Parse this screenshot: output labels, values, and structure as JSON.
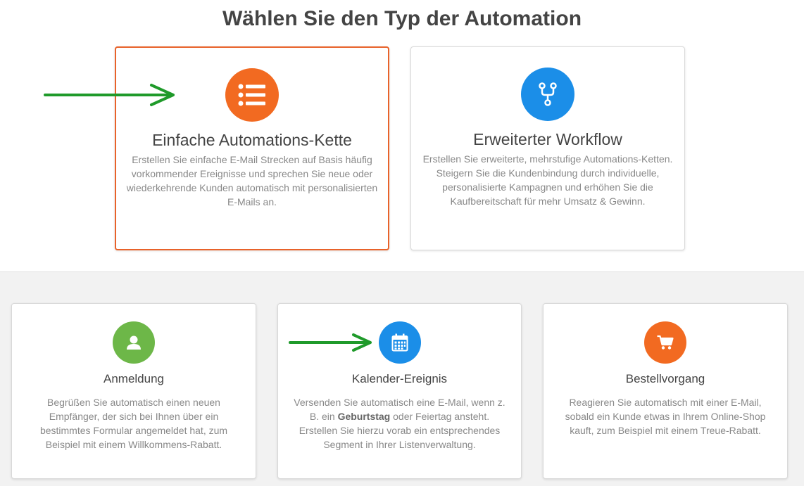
{
  "page": {
    "title": "Wählen Sie den Typ der Automation"
  },
  "cards_top": [
    {
      "title": "Einfache Automations-Kette",
      "description": "Erstellen Sie einfache E-Mail Strecken auf Basis häufig vorkommender Ereignisse und sprechen Sie neue oder wiederkehrende Kunden automatisch mit personalisierten E-Mails an.",
      "icon": "list-icon",
      "color": "#f26a21",
      "selected": true
    },
    {
      "title": "Erweiterter Workflow",
      "description": "Erstellen Sie erweiterte, mehrstufige Automations-Ketten. Steigern Sie die Kundenbindung durch individuelle, personalisierte Kampagnen und erhöhen Sie die Kaufbereitschaft für mehr Umsatz & Gewinn.",
      "icon": "branch-icon",
      "color": "#1b8ee8",
      "selected": false
    }
  ],
  "cards_bottom": [
    {
      "title": "Anmeldung",
      "description": "Begrüßen Sie automatisch einen neuen Empfänger, der sich bei Ihnen über ein bestimmtes Formular angemeldet hat, zum Beispiel mit einem Willkommens-Rabatt.",
      "icon": "user-icon",
      "color": "#6db748"
    },
    {
      "title": "Kalender-Ereignis",
      "description_before": "Versenden Sie automatisch eine E-Mail, wenn z. B. ein ",
      "description_bold": "Geburtstag",
      "description_after": " oder Feiertag ansteht. Erstellen Sie hierzu vorab ein entsprechendes Segment in Ihrer Listenverwaltung.",
      "icon": "calendar-icon",
      "color": "#1b8ee8"
    },
    {
      "title": "Bestellvorgang",
      "description": "Reagieren Sie automatisch mit einer E-Mail, sobald ein Kunde etwas in Ihrem Online-Shop kauft, zum Beispiel mit einem Treue-Rabatt.",
      "icon": "cart-icon",
      "color": "#f26a21"
    }
  ],
  "annotations": {
    "arrow_color": "#1f9a2a"
  }
}
